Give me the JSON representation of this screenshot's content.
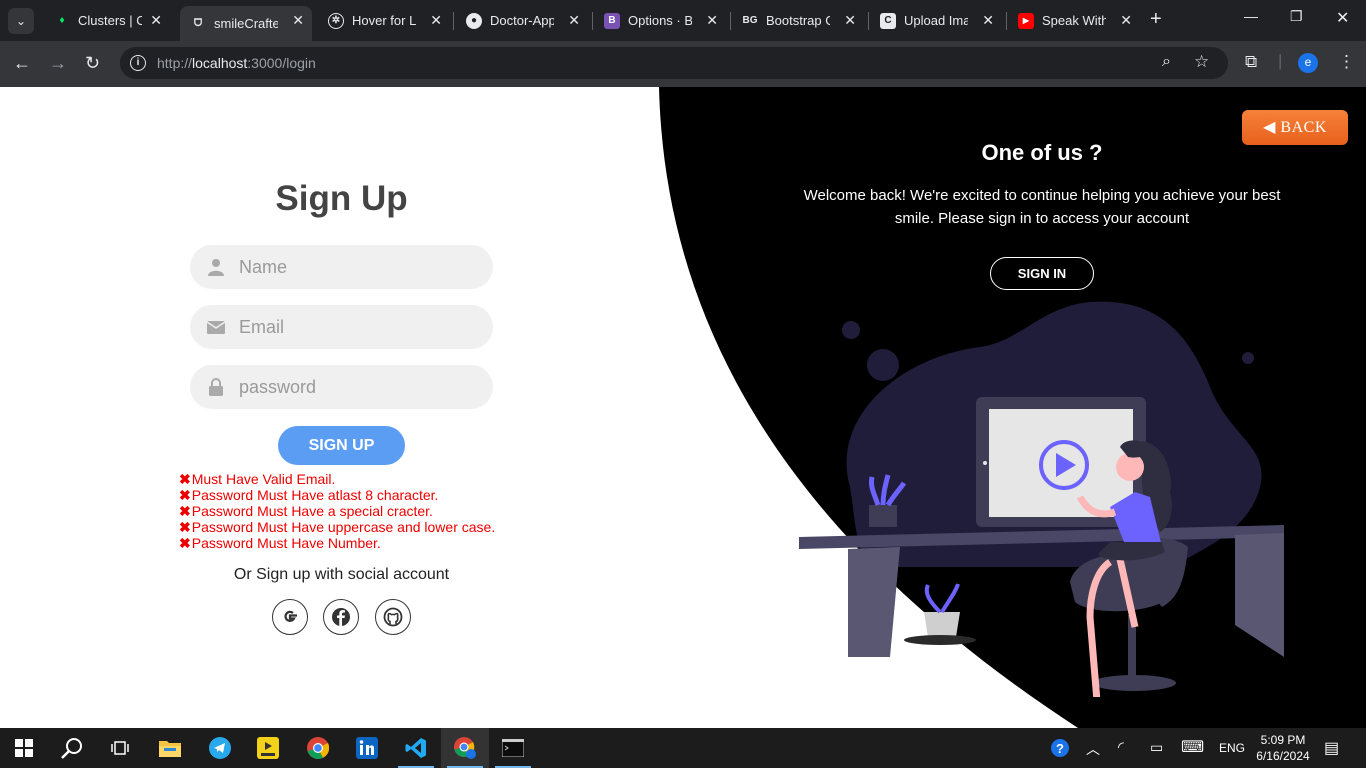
{
  "browser": {
    "tabs": [
      {
        "title": "Clusters | Clo",
        "icon": "mongodb-leaf-icon"
      },
      {
        "title": "smileCrafted",
        "icon": "tooth-icon",
        "active": true
      },
      {
        "title": "Hover for Lo",
        "icon": "openai-icon"
      },
      {
        "title": "Doctor-Appo",
        "icon": "github-icon"
      },
      {
        "title": "Options · Bo",
        "icon": "bootstrap-icon"
      },
      {
        "title": "Bootstrap Ga",
        "icon": "bg-icon"
      },
      {
        "title": "Upload Imag",
        "icon": "c-icon"
      },
      {
        "title": "Speak With I",
        "icon": "youtube-icon"
      }
    ],
    "url_prefix": "http://",
    "url_host": "localhost",
    "url_rest": ":3000/login",
    "profile_initial": "e"
  },
  "signup": {
    "title": "Sign Up",
    "name_placeholder": "Name",
    "email_placeholder": "Email",
    "password_placeholder": "password",
    "button": "SIGN UP",
    "errors": [
      "Must Have Valid Email.",
      "Password Must Have atlast 8 character.",
      "Password Must Have a special cracter.",
      "Password Must Have uppercase and lower case.",
      "Password Must Have Number."
    ],
    "social_text": "Or Sign up with social account"
  },
  "panel": {
    "back": "BACK",
    "heading": "One of us ?",
    "line1": "Welcome back! We're excited to continue helping you achieve your best",
    "line2": "smile. Please sign in to access your account",
    "signin": "SIGN IN"
  },
  "taskbar": {
    "time": "5:09 PM",
    "date": "6/16/2024",
    "lang": "ENG"
  },
  "colors": {
    "accent_blue": "#5c9df4",
    "error_red": "#ee0000",
    "back_orange": "#f5813a",
    "illustration_purple": "#6c63ff"
  }
}
